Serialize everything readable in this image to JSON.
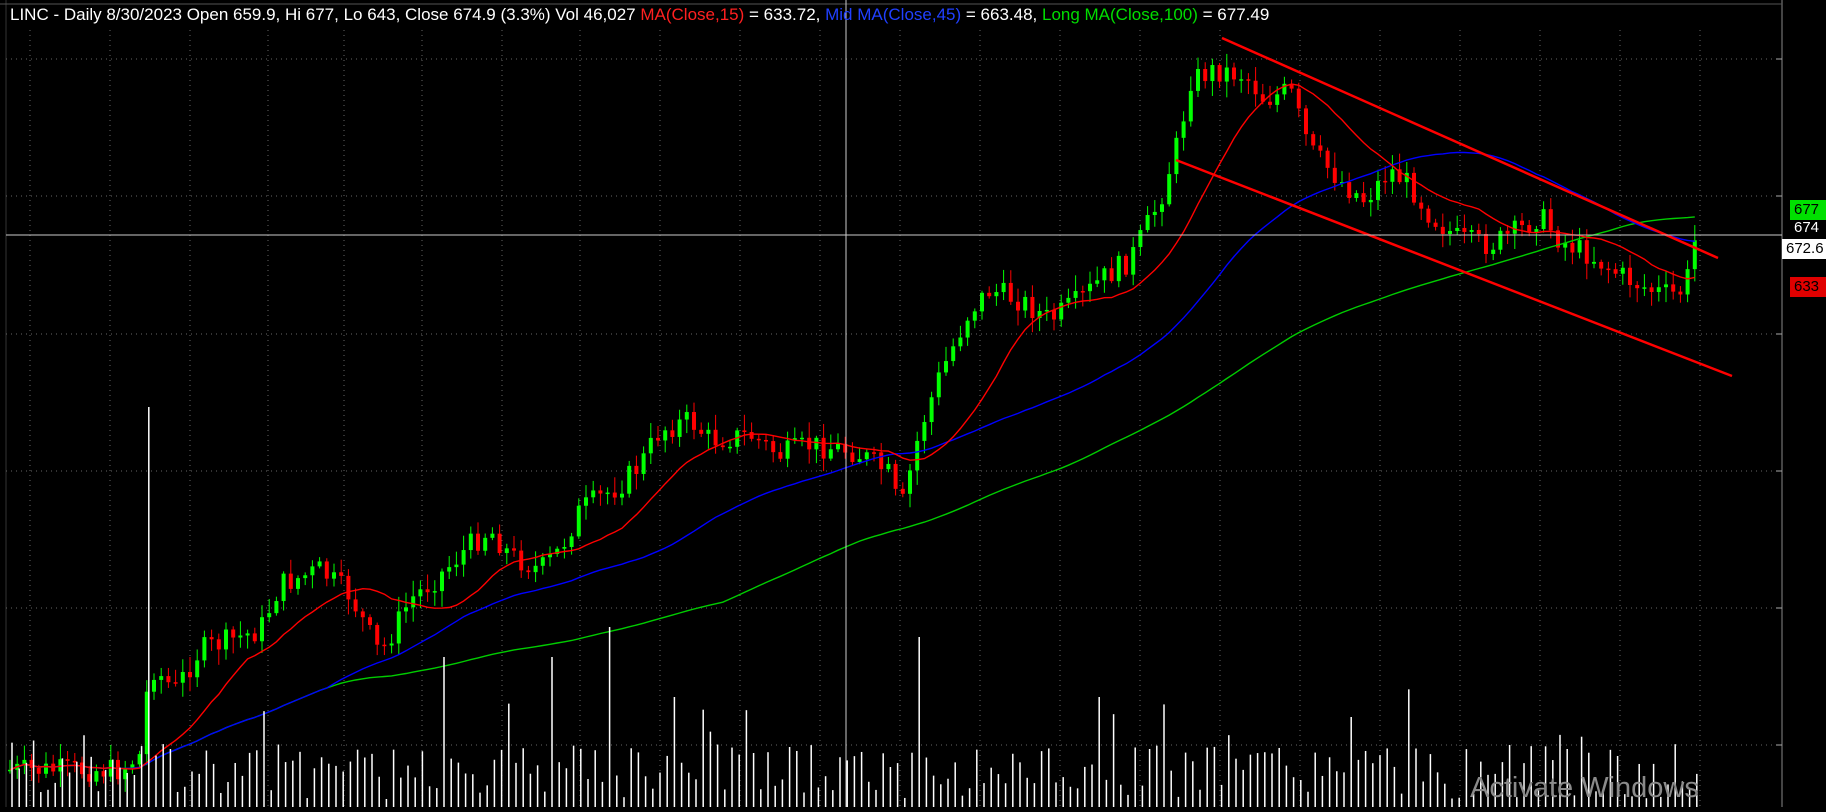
{
  "header": {
    "symbol_line": "LINC - Daily 8/30/2023 Open 659.9, Hi 677, Lo 643, Close 674.9 (3.3%) Vol 46,027 ",
    "ma15_label": "MA(Close,15)",
    "ma15_value": " = 633.72, ",
    "ma45_label": "Mid MA(Close,45)",
    "ma45_value": " = 663.48, ",
    "ma100_label": "Long MA(Close,100)",
    "ma100_value": " = 677.49"
  },
  "price_tags": [
    {
      "text": "677",
      "bg": "#00e000",
      "fg": "#000000"
    },
    {
      "text": "674",
      "bg": "#000000",
      "fg": "#ffffff"
    },
    {
      "text": "672.6",
      "bg": "#ffffff",
      "fg": "#000000"
    },
    {
      "text": "633",
      "bg": "#e00000",
      "fg": "#000000"
    }
  ],
  "watermark": "Activate Windows",
  "colors": {
    "background": "#000000",
    "up_candle": "#00ff00",
    "down_candle": "#ff0000",
    "ma15": "#ff0000",
    "ma45": "#0000ff",
    "ma100": "#00cc00",
    "volume": "#ffffff",
    "channel": "#ff0000",
    "grid": "#666666"
  },
  "chart_data": {
    "type": "candlestick",
    "symbol": "LINC",
    "interval": "Daily",
    "last_bar": {
      "date": "8/30/2023",
      "open": 659.9,
      "high": 677,
      "low": 643,
      "close": 674.9,
      "change_pct": 3.3,
      "volume": 46027
    },
    "indicators": [
      {
        "name": "MA(Close,15)",
        "value": 633.72
      },
      {
        "name": "Mid MA(Close,45)",
        "value": 663.48
      },
      {
        "name": "Long MA(Close,100)",
        "value": 677.49
      }
    ],
    "axis_tags": [
      677,
      674,
      672.6,
      633
    ],
    "drawn_channel": "descending",
    "crosshair": true,
    "grid": true
  }
}
